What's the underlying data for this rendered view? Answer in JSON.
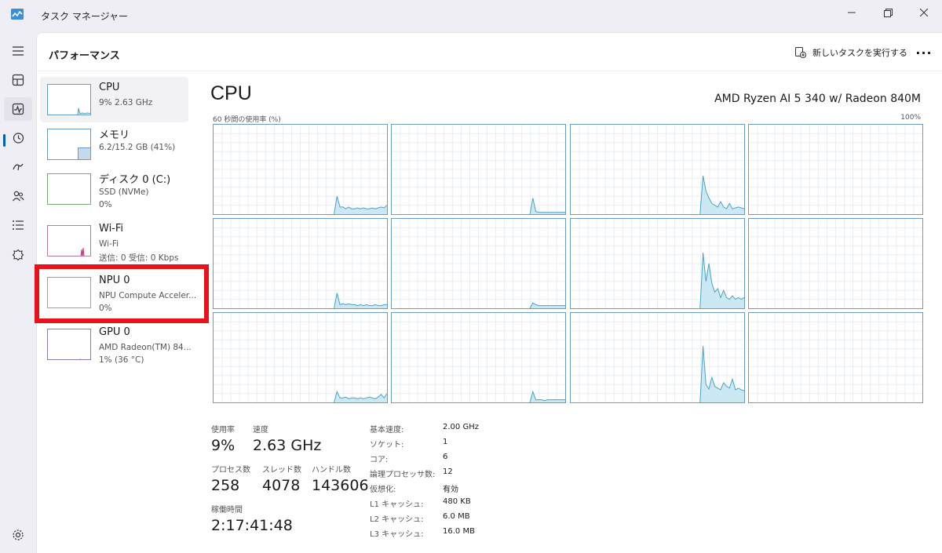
{
  "window": {
    "title": "タスク マネージャー",
    "icon": "task-manager-icon"
  },
  "header": {
    "title": "パフォーマンス",
    "new_task_label": "新しいタスクを実行する",
    "more_label": "···"
  },
  "nav": [
    "hamburger-icon",
    "processes-icon",
    "performance-icon",
    "app-history-icon",
    "startup-apps-icon",
    "users-icon",
    "details-icon",
    "services-icon",
    "settings-icon"
  ],
  "devices": [
    {
      "name": "CPU",
      "line1": "9%  2.63 GHz",
      "line2": ""
    },
    {
      "name": "メモリ",
      "line1": "6.2/15.2 GB (41%)",
      "line2": ""
    },
    {
      "name": "ディスク 0 (C:)",
      "line1": "SSD (NVMe)",
      "line2": "0%"
    },
    {
      "name": "Wi-Fi",
      "line1": "Wi-Fi",
      "line2": "送信: 0  受信: 0 Kbps"
    },
    {
      "name": "NPU 0",
      "line1": "NPU Compute Acceler...",
      "line2": "0%"
    },
    {
      "name": "GPU 0",
      "line1": "AMD Radeon(TM) 84...",
      "line2": "1% (36 °C)"
    }
  ],
  "cpu": {
    "title": "CPU",
    "model": "AMD Ryzen AI 5 340 w/ Radeon 840M",
    "graph_label": "60 秒間の使用率 (%)",
    "graph_max": "100%"
  },
  "stats": {
    "usage_label": "使用率",
    "usage_value": "9%",
    "speed_label": "速度",
    "speed_value": "2.63 GHz",
    "processes_label": "プロセス数",
    "processes_value": "258",
    "threads_label": "スレッド数",
    "threads_value": "4078",
    "handles_label": "ハンドル数",
    "handles_value": "143606",
    "uptime_label": "稼働時間",
    "uptime_value": "2:17:41:48"
  },
  "specs": [
    {
      "key": "基本速度:",
      "value": "2.00 GHz"
    },
    {
      "key": "ソケット:",
      "value": "1"
    },
    {
      "key": "コア:",
      "value": "6"
    },
    {
      "key": "論理プロセッサ数:",
      "value": "12"
    },
    {
      "key": "仮想化:",
      "value": "有効"
    },
    {
      "key": "L1 キャッシュ:",
      "value": "480 KB"
    },
    {
      "key": "L2 キャッシュ:",
      "value": "6.0 MB"
    },
    {
      "key": "L3 キャッシュ:",
      "value": "16.0 MB"
    }
  ],
  "colors": {
    "graph_line": "#4ba3c7",
    "graph_fill": "#cbe8f3",
    "grid_line": "#e8eef3",
    "highlight": "#e8121b",
    "memory_fill": "#c5d9ee",
    "wifi_line": "#c4327c"
  },
  "chart_data": {
    "type": "area",
    "samples": 60,
    "ylim": [
      0,
      100
    ],
    "series": [
      {
        "values": [
          0,
          0,
          0,
          0,
          0,
          0,
          0,
          0,
          0,
          0,
          0,
          0,
          0,
          0,
          0,
          0,
          0,
          0,
          0,
          0,
          0,
          0,
          0,
          0,
          0,
          0,
          0,
          0,
          0,
          0,
          0,
          0,
          0,
          0,
          0,
          0,
          0,
          0,
          0,
          0,
          0,
          0,
          20,
          8,
          8,
          6,
          8,
          6,
          6,
          7,
          6,
          7,
          6,
          6,
          7,
          6,
          7,
          8,
          7,
          10
        ]
      },
      {
        "values": [
          0,
          0,
          0,
          0,
          0,
          0,
          0,
          0,
          0,
          0,
          0,
          0,
          0,
          0,
          0,
          0,
          0,
          0,
          0,
          0,
          0,
          0,
          0,
          0,
          0,
          0,
          0,
          0,
          0,
          0,
          0,
          0,
          0,
          0,
          0,
          0,
          0,
          0,
          0,
          0,
          0,
          0,
          0,
          0,
          0,
          0,
          0,
          0,
          18,
          3,
          2,
          2,
          2,
          2,
          2,
          2,
          2,
          2,
          2,
          2
        ]
      },
      {
        "values": [
          0,
          0,
          0,
          0,
          0,
          0,
          0,
          0,
          0,
          0,
          0,
          0,
          0,
          0,
          0,
          0,
          0,
          0,
          0,
          0,
          0,
          0,
          0,
          0,
          0,
          0,
          0,
          0,
          0,
          0,
          0,
          0,
          0,
          0,
          0,
          0,
          0,
          0,
          0,
          0,
          0,
          0,
          0,
          0,
          0,
          43,
          26,
          18,
          12,
          10,
          8,
          14,
          8,
          6,
          12,
          6,
          7,
          8,
          7,
          6
        ]
      },
      {
        "values": [
          0,
          0,
          0,
          0,
          0,
          0,
          0,
          0,
          0,
          0,
          0,
          0,
          0,
          0,
          0,
          0,
          0,
          0,
          0,
          0,
          0,
          0,
          0,
          0,
          0,
          0,
          0,
          0,
          0,
          0,
          0,
          0,
          0,
          0,
          0,
          0,
          0,
          0,
          0,
          0,
          0,
          0,
          0,
          0,
          0,
          0,
          0,
          0,
          0,
          0,
          0,
          0,
          0,
          0,
          0,
          0,
          0,
          0,
          0,
          0
        ]
      },
      {
        "values": [
          0,
          0,
          0,
          0,
          0,
          0,
          0,
          0,
          0,
          0,
          0,
          0,
          0,
          0,
          0,
          0,
          0,
          0,
          0,
          0,
          0,
          0,
          0,
          0,
          0,
          0,
          0,
          0,
          0,
          0,
          0,
          0,
          0,
          0,
          0,
          0,
          0,
          0,
          0,
          0,
          0,
          0,
          17,
          4,
          5,
          4,
          5,
          4,
          4,
          3,
          4,
          3,
          4,
          3,
          3,
          4,
          3,
          3,
          4,
          4
        ]
      },
      {
        "values": [
          0,
          0,
          0,
          0,
          0,
          0,
          0,
          0,
          0,
          0,
          0,
          0,
          0,
          0,
          0,
          0,
          0,
          0,
          0,
          0,
          0,
          0,
          0,
          0,
          0,
          0,
          0,
          0,
          0,
          0,
          0,
          0,
          0,
          0,
          0,
          0,
          0,
          0,
          0,
          0,
          0,
          0,
          0,
          0,
          0,
          0,
          0,
          0,
          6,
          4,
          3,
          3,
          3,
          3,
          3,
          3,
          3,
          3,
          3,
          3
        ]
      },
      {
        "values": [
          0,
          0,
          0,
          0,
          0,
          0,
          0,
          0,
          0,
          0,
          0,
          0,
          0,
          0,
          0,
          0,
          0,
          0,
          0,
          0,
          0,
          0,
          0,
          0,
          0,
          0,
          0,
          0,
          0,
          0,
          0,
          0,
          0,
          0,
          0,
          0,
          0,
          0,
          0,
          0,
          0,
          0,
          0,
          0,
          0,
          62,
          30,
          50,
          28,
          18,
          22,
          12,
          20,
          12,
          10,
          14,
          10,
          12,
          10,
          12
        ]
      },
      {
        "values": [
          0,
          0,
          0,
          0,
          0,
          0,
          0,
          0,
          0,
          0,
          0,
          0,
          0,
          0,
          0,
          0,
          0,
          0,
          0,
          0,
          0,
          0,
          0,
          0,
          0,
          0,
          0,
          0,
          0,
          0,
          0,
          0,
          0,
          0,
          0,
          0,
          0,
          0,
          0,
          0,
          0,
          0,
          0,
          0,
          0,
          0,
          0,
          0,
          0,
          0,
          0,
          0,
          0,
          0,
          0,
          0,
          0,
          0,
          0,
          0
        ]
      },
      {
        "values": [
          0,
          0,
          0,
          0,
          0,
          0,
          0,
          0,
          0,
          0,
          0,
          0,
          0,
          0,
          0,
          0,
          0,
          0,
          0,
          0,
          0,
          0,
          0,
          0,
          0,
          0,
          0,
          0,
          0,
          0,
          0,
          0,
          0,
          0,
          0,
          0,
          0,
          0,
          0,
          0,
          0,
          0,
          12,
          5,
          5,
          6,
          4,
          5,
          5,
          4,
          5,
          4,
          5,
          6,
          5,
          4,
          6,
          9,
          5,
          10
        ]
      },
      {
        "values": [
          0,
          0,
          0,
          0,
          0,
          0,
          0,
          0,
          0,
          0,
          0,
          0,
          0,
          0,
          0,
          0,
          0,
          0,
          0,
          0,
          0,
          0,
          0,
          0,
          0,
          0,
          0,
          0,
          0,
          0,
          0,
          0,
          0,
          0,
          0,
          0,
          0,
          0,
          0,
          0,
          0,
          0,
          0,
          0,
          0,
          0,
          0,
          0,
          12,
          3,
          3,
          3,
          2,
          3,
          3,
          3,
          3,
          3,
          3,
          3
        ]
      },
      {
        "values": [
          0,
          0,
          0,
          0,
          0,
          0,
          0,
          0,
          0,
          0,
          0,
          0,
          0,
          0,
          0,
          0,
          0,
          0,
          0,
          0,
          0,
          0,
          0,
          0,
          0,
          0,
          0,
          0,
          0,
          0,
          0,
          0,
          0,
          0,
          0,
          0,
          0,
          0,
          0,
          0,
          0,
          0,
          0,
          0,
          0,
          63,
          20,
          15,
          28,
          18,
          16,
          14,
          22,
          18,
          16,
          26,
          14,
          16,
          14,
          13
        ]
      },
      {
        "values": [
          0,
          0,
          0,
          0,
          0,
          0,
          0,
          0,
          0,
          0,
          0,
          0,
          0,
          0,
          0,
          0,
          0,
          0,
          0,
          0,
          0,
          0,
          0,
          0,
          0,
          0,
          0,
          0,
          0,
          0,
          0,
          0,
          0,
          0,
          0,
          0,
          0,
          0,
          0,
          0,
          0,
          0,
          0,
          0,
          0,
          0,
          0,
          0,
          0,
          0,
          0,
          0,
          0,
          0,
          0,
          0,
          0,
          0,
          0,
          0
        ]
      }
    ]
  }
}
